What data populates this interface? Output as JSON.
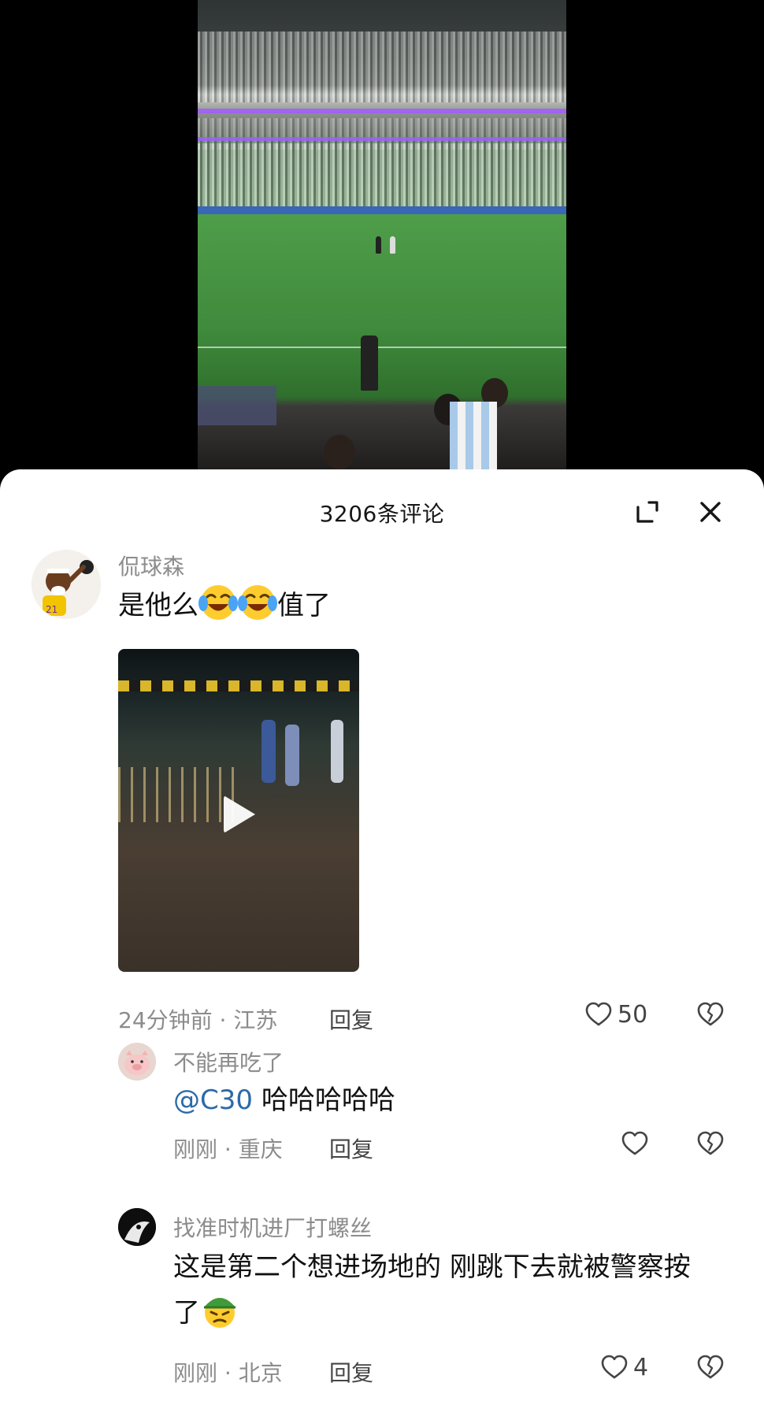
{
  "panel": {
    "title": "3206条评论"
  },
  "comments": [
    {
      "user": "侃球森",
      "text_before": "是他么",
      "text_after": "值了",
      "emoji": [
        "laughing-tears-emoji",
        "laughing-tears-emoji"
      ],
      "time": "24分钟前",
      "location": "江苏",
      "reply_label": "回复",
      "likes": "50"
    },
    {
      "user": "不能再吃了",
      "mention": "@C30",
      "text": "哈哈哈哈哈",
      "time": "刚刚",
      "location": "重庆",
      "reply_label": "回复",
      "likes": ""
    },
    {
      "user": "找准时机进厂打螺丝",
      "text_line1": "这是第二个想进场地的 刚跳下去就被警察按",
      "text_line2": "了",
      "emoji": [
        "green-hat-angry-emoji"
      ],
      "time": "刚刚",
      "location": "北京",
      "reply_label": "回复",
      "likes": "4"
    }
  ],
  "separator": " · ",
  "colors": {
    "mention": "#2c6aa8",
    "meta": "#8c8c8c",
    "panel_bg": "#ffffff"
  }
}
